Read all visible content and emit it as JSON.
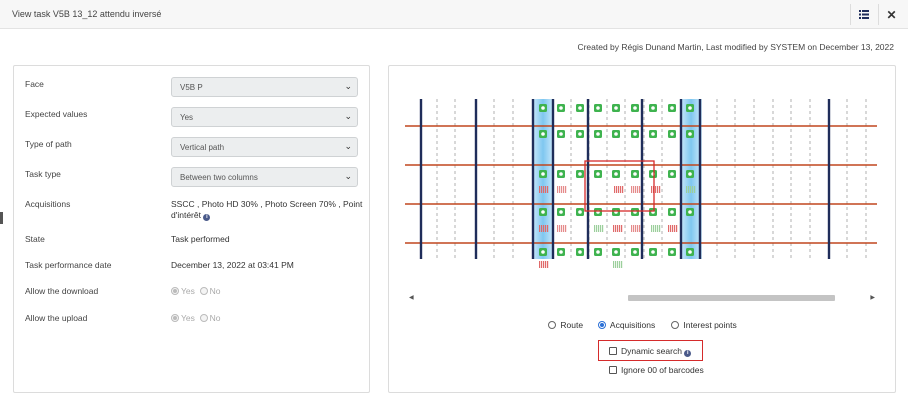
{
  "window": {
    "title": "View task V5B 13_12 attendu inversé",
    "created_info": "Created by Régis Dunand Martin, Last modified by SYSTEM on December 13, 2022"
  },
  "form": {
    "face_label": "Face",
    "face_value": "V5B P",
    "expected_label": "Expected values",
    "expected_value": "Yes",
    "path_label": "Type of path",
    "path_value": "Vertical path",
    "tasktype_label": "Task type",
    "tasktype_value": "Between two columns",
    "acq_label": "Acquisitions",
    "acq_value_line1": "SSCC , Photo HD 30% , Photo Screen 70% , Point",
    "acq_value_line2": "d'intérêt",
    "state_label": "State",
    "state_value": "Task performed",
    "perf_label": "Task performance date",
    "perf_value": "December 13, 2022 at 03:41 PM",
    "download_label": "Allow the download",
    "upload_label": "Allow the upload",
    "yes": "Yes",
    "no": "No"
  },
  "view": {
    "options": [
      "Route",
      "Acquisitions",
      "Interest points"
    ],
    "selected_option": "Acquisitions",
    "dynamic_search": "Dynamic search",
    "ignore_barcodes": "Ignore 00 of barcodes"
  },
  "icons": {
    "list": "list-icon",
    "close": "close-icon",
    "info": "info-icon",
    "camera": "camera-icon"
  },
  "colors": {
    "column": "#1f2d5a",
    "shelf": "#c0461e",
    "highlight": "#7fc7f0",
    "camera": "#3fb34f",
    "highlight_box": "#d52b2b"
  }
}
